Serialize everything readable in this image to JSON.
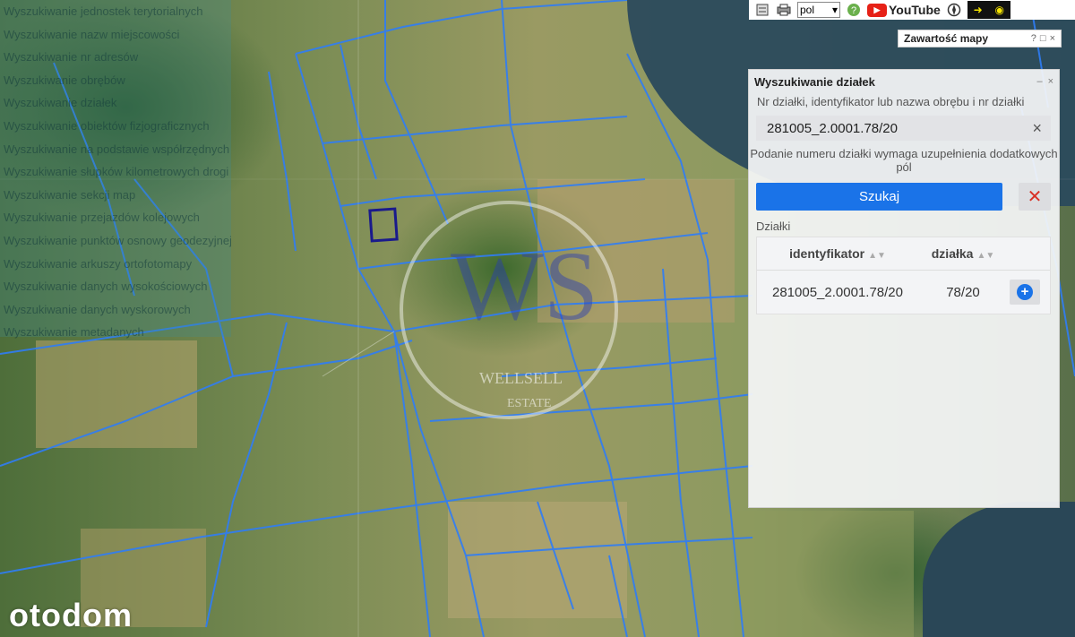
{
  "map": {
    "layer_list": [
      "Wyszukiwanie jednostek terytorialnych",
      "Wyszukiwanie nazw miejscowości",
      "Wyszukiwanie nr adresów",
      "Wyszukiwanie obrębów",
      "Wyszukiwanie działek",
      "Wyszukiwanie obiektów fizjograficznych",
      "Wyszukiwanie na podstawie współrzędnych",
      "Wyszukiwanie słupków kilometrowych drogi",
      "Wyszukiwanie sekcji map",
      "Wyszukiwanie przejazdów kolejowych",
      "Wyszukiwanie punktów osnowy geodezyjnej",
      "Wyszukiwanie arkuszy ortofotomapy",
      "Wyszukiwanie danych wysokościowych",
      "Wyszukiwanie danych wyskorowych",
      "Wyszukiwanie metadanych"
    ],
    "watermark_text_1": "WELLSELL",
    "watermark_text_2": "ESTATE",
    "watermark_mono": "WS",
    "portal_logo": "otodom",
    "parcel_highlight_color": "#1a1a8c",
    "parcel_line_color": "#2f7df6"
  },
  "toolbar": {
    "icons": [
      "calculator-icon",
      "printer-icon",
      "help-icon",
      "compass-icon",
      "eye-icon"
    ],
    "language_value": "pol",
    "youtube_label": "YouTube"
  },
  "content_bar": {
    "title": "Zawartość mapy",
    "controls": [
      "?",
      "□",
      "×"
    ]
  },
  "panel": {
    "title": "Wyszukiwanie działek",
    "controls": [
      "–",
      "×"
    ],
    "field_label": "Nr działki, identyfikator lub nazwa obrębu i nr działki",
    "field_value": "281005_2.0001.78/20",
    "field_clear": "×",
    "hint": "Podanie numeru działki wymaga uzupełnienia dodatkowych pól",
    "search_button": "Szukaj",
    "clear_button": "✕",
    "results_label": "Działki",
    "columns": [
      "identyfikator",
      "działka"
    ],
    "rows": [
      {
        "identyfikator": "281005_2.0001.78/20",
        "dzialka": "78/20"
      }
    ],
    "add_symbol": "+",
    "accent": "#1a73e8",
    "danger": "#d93025"
  }
}
